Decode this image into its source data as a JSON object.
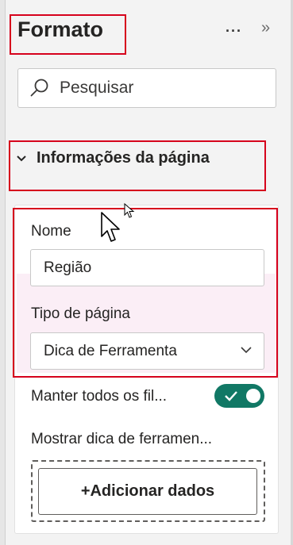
{
  "header": {
    "title": "Formato",
    "more_icon": "more-options-icon",
    "expand_icon": "expand-pane-icon"
  },
  "search": {
    "placeholder": "Pesquisar",
    "icon": "search-icon"
  },
  "section": {
    "title": "Informações da página",
    "expanded": true
  },
  "fields": {
    "name_label": "Nome",
    "name_value": "Região",
    "page_type_label": "Tipo de página",
    "page_type_value": "Dica de Ferramenta",
    "keep_filters_label": "Manter todos os fil...",
    "keep_filters_on": true,
    "show_tooltip_label": "Mostrar dica de ferramen...",
    "add_data_label": "+Adicionar dados"
  },
  "colors": {
    "highlight": "#d6001c",
    "toggle_on": "#117865",
    "band": "#fbeef6"
  }
}
